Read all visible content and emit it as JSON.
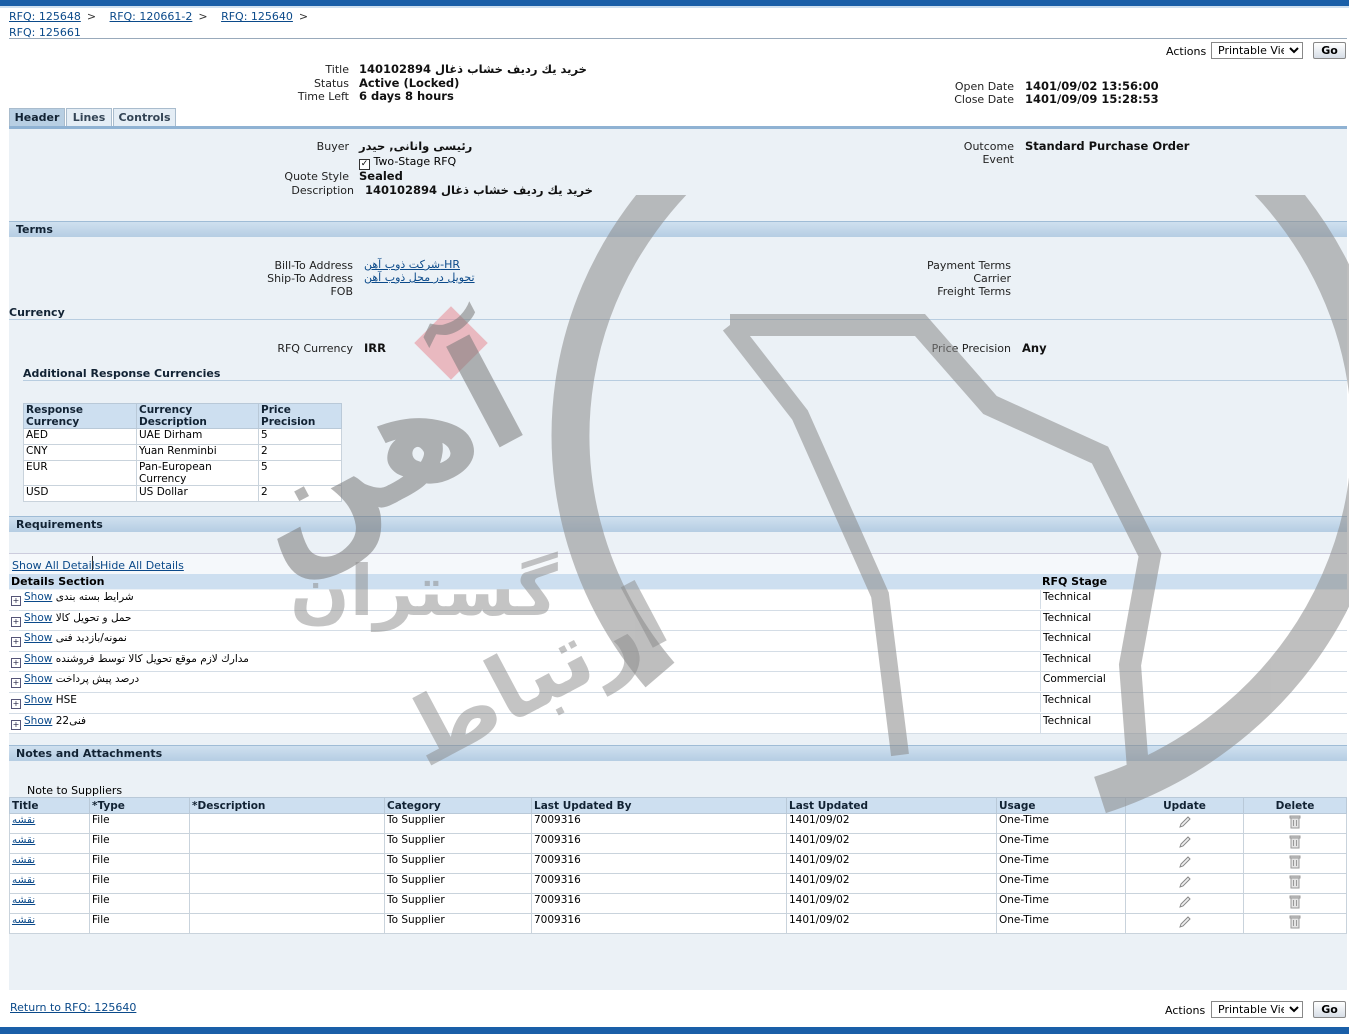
{
  "breadcrumbs": [
    "RFQ: 125648",
    "RFQ: 120661-2",
    "RFQ: 125640"
  ],
  "breadcrumb_separator": ">",
  "page_title": "RFQ: 125661",
  "actions": {
    "label": "Actions",
    "selected": "Printable View",
    "go": "Go"
  },
  "summary": {
    "title_label": "Title",
    "title_value": "خرید یك ردیف خشاب ذغال 140102894",
    "status_label": "Status",
    "status_value": "Active (Locked)",
    "timeleft_label": "Time Left",
    "timeleft_value": "6 days 8 hours",
    "open_label": "Open Date",
    "open_value": "1401/09/02 13:56:00",
    "close_label": "Close Date",
    "close_value": "1401/09/09 15:28:53"
  },
  "tabs": [
    {
      "label": "Header"
    },
    {
      "label": "Lines"
    },
    {
      "label": "Controls"
    }
  ],
  "header": {
    "buyer_label": "Buyer",
    "buyer_value": "رئیسی وانانی, حیدر",
    "two_stage_label": "Two-Stage RFQ",
    "quote_style_label": "Quote Style",
    "quote_style_value": "Sealed",
    "description_label": "Description",
    "description_value": "خرید یك ردیف خشاب ذغال 140102894",
    "outcome_label": "Outcome",
    "outcome_value": "Standard Purchase Order",
    "event_label": "Event"
  },
  "terms": {
    "section": "Terms",
    "billto_label": "Bill-To Address",
    "billto_value": "شرکت ذوب آهن-HR",
    "shipto_label": "Ship-To Address",
    "shipto_value": "تحویل در محل ذوب آهن",
    "fob_label": "FOB",
    "payment_label": "Payment Terms",
    "carrier_label": "Carrier",
    "freight_label": "Freight Terms"
  },
  "currency": {
    "section": "Currency",
    "rfq_currency_label": "RFQ Currency",
    "rfq_currency_value": "IRR",
    "precision_label": "Price Precision",
    "precision_value": "Any",
    "additional_title": "Additional Response Currencies",
    "columns": [
      "Response Currency",
      "Currency Description",
      "Price Precision"
    ],
    "rows": [
      [
        "AED",
        "UAE Dirham",
        "5"
      ],
      [
        "CNY",
        "Yuan Renminbi",
        "2"
      ],
      [
        "EUR",
        "Pan-European Currency",
        "5"
      ],
      [
        "USD",
        "US Dollar",
        "2"
      ]
    ]
  },
  "requirements": {
    "section": "Requirements",
    "show_all": "Show All Details",
    "hide_all": "Hide All Details",
    "col_section": "Details Section",
    "col_stage": "RFQ Stage",
    "show_label": "Show",
    "rows": [
      {
        "name": "شرایط بسته بندی",
        "stage": "Technical"
      },
      {
        "name": "حمل و تحویل کالا",
        "stage": "Technical"
      },
      {
        "name": "نمونه/بازدید فنی",
        "stage": "Technical"
      },
      {
        "name": "مدارك لازم موقع تحویل کالا توسط فروشنده",
        "stage": "Technical"
      },
      {
        "name": "درصد پیش پرداخت",
        "stage": "Commercial"
      },
      {
        "name": "HSE",
        "stage": "Technical"
      },
      {
        "name": "فنی22",
        "stage": "Technical"
      }
    ]
  },
  "notes": {
    "section": "Notes and Attachments",
    "note_label": "Note to Suppliers",
    "columns": [
      "Title",
      "*Type",
      "*Description",
      "Category",
      "Last Updated By",
      "Last Updated",
      "Usage",
      "Update",
      "Delete"
    ],
    "rows": [
      [
        "نقشه",
        "File",
        "",
        "To Supplier",
        "7009316",
        "1401/09/02",
        "One-Time"
      ],
      [
        "نقشه",
        "File",
        "",
        "To Supplier",
        "7009316",
        "1401/09/02",
        "One-Time"
      ],
      [
        "نقشه",
        "File",
        "",
        "To Supplier",
        "7009316",
        "1401/09/02",
        "One-Time"
      ],
      [
        "نقشه",
        "File",
        "",
        "To Supplier",
        "7009316",
        "1401/09/02",
        "One-Time"
      ],
      [
        "نقشه",
        "File",
        "",
        "To Supplier",
        "7009316",
        "1401/09/02",
        "One-Time"
      ],
      [
        "نقشه",
        "File",
        "",
        "To Supplier",
        "7009316",
        "1401/09/02",
        "One-Time"
      ]
    ]
  },
  "return_link": "Return to RFQ: 125640",
  "watermark": {
    "text1": "آهن",
    "text2": "گستران",
    "text3": "ارتباط"
  },
  "colors": {
    "accent": "#1a5fa8",
    "panel": "#ebf1f6",
    "section": "#b5cde3",
    "link": "#0b4a8a"
  }
}
